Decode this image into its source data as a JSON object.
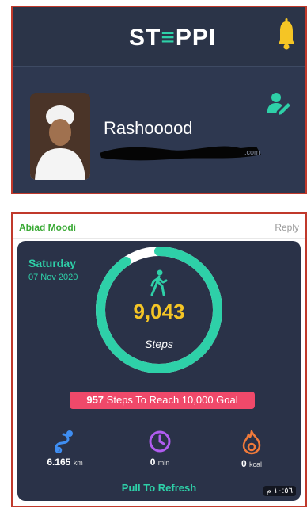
{
  "header": {
    "logo_text": "ST",
    "logo_e": "≡",
    "logo_rest": "PPI"
  },
  "profile": {
    "username": "Rashooood",
    "email_partial": ".com"
  },
  "message": {
    "sender": "Abiad Moodi",
    "reply_label": "Reply"
  },
  "steps": {
    "day": "Saturday",
    "date": "07 Nov 2020",
    "count": "9,043",
    "label": "Steps",
    "goal_number": "957",
    "goal_text": " Steps To Reach 10,000 Goal",
    "progress_fraction": 0.9043
  },
  "stats": [
    {
      "value": "6.165",
      "unit": "km",
      "icon": "distance-route-icon",
      "color": "#3f8ef2"
    },
    {
      "value": "0",
      "unit": "min",
      "icon": "clock-icon",
      "color": "#b05cf0"
    },
    {
      "value": "0",
      "unit": "kcal",
      "icon": "flame-icon",
      "color": "#f07a3a"
    }
  ],
  "refresh_label": "Pull To Refresh",
  "timestamp": "١٠:٥٦ م",
  "colors": {
    "accent": "#2ed0a8",
    "bell": "#f5c525",
    "step_count": "#f5c525",
    "goal_badge": "#f0496a",
    "panel": "#2a3248",
    "frame": "#c0392b"
  }
}
